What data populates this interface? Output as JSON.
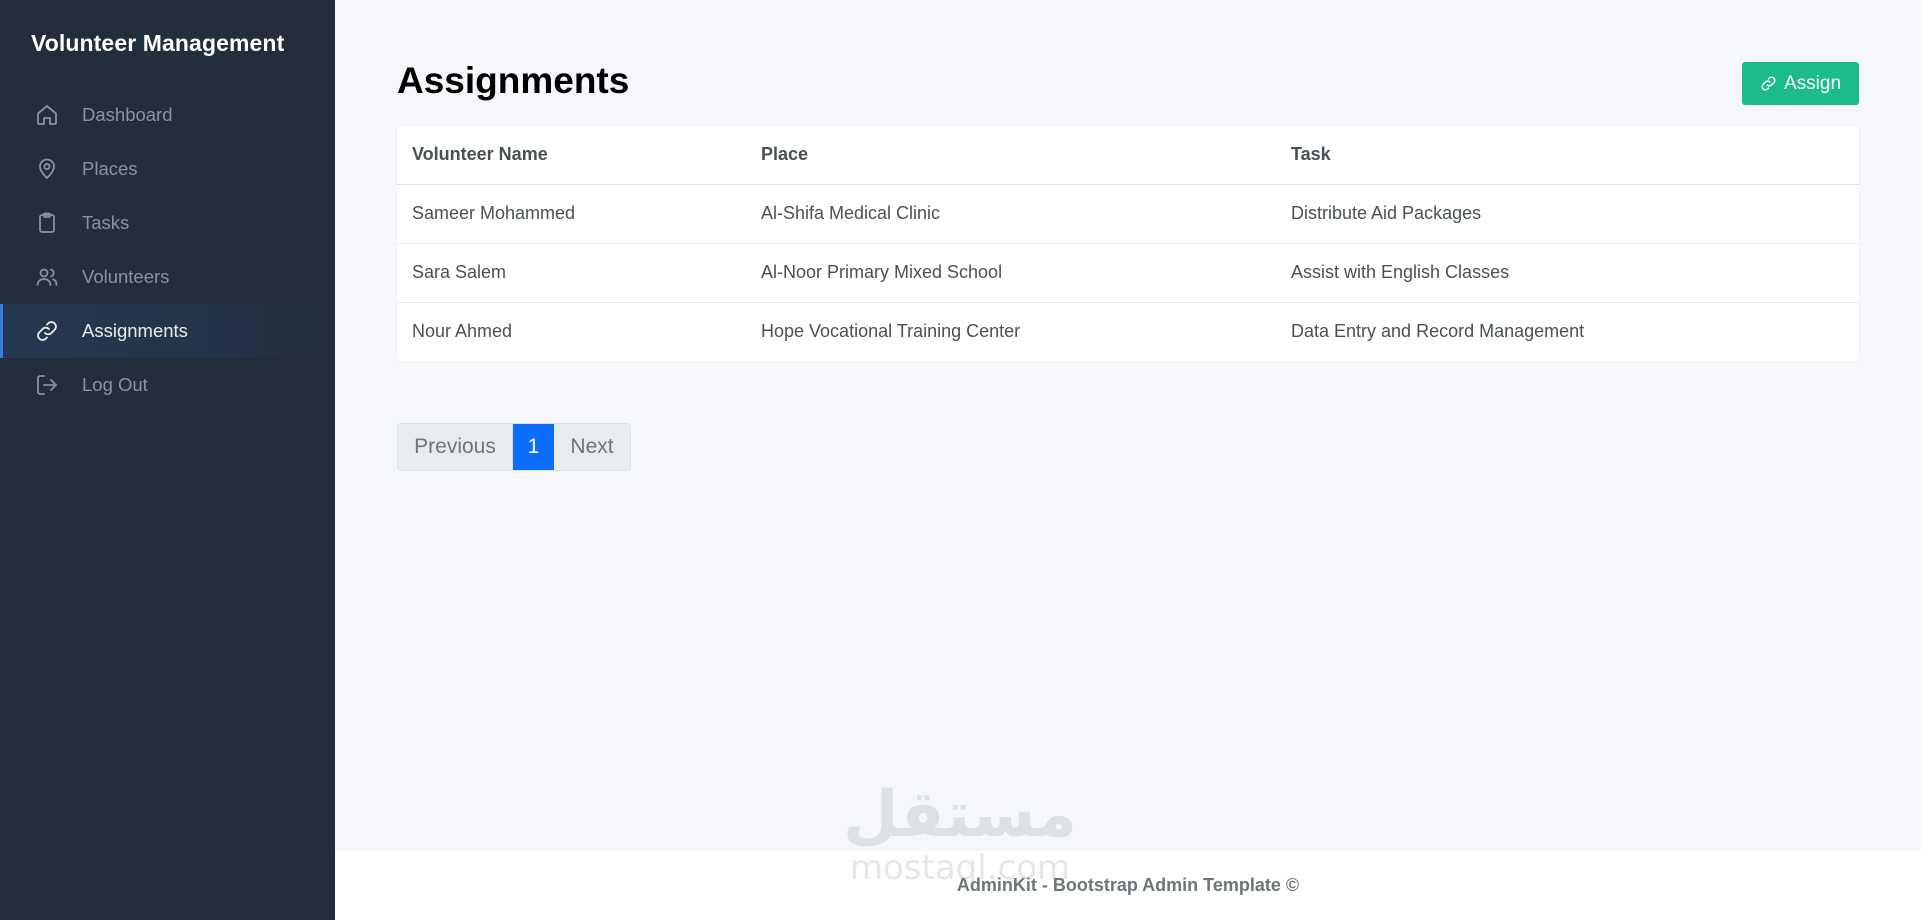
{
  "sidebar": {
    "brand": "Volunteer Management",
    "items": [
      {
        "label": "Dashboard",
        "icon": "home-icon",
        "active": false
      },
      {
        "label": "Places",
        "icon": "map-pin-icon",
        "active": false
      },
      {
        "label": "Tasks",
        "icon": "clipboard-icon",
        "active": false
      },
      {
        "label": "Volunteers",
        "icon": "users-icon",
        "active": false
      },
      {
        "label": "Assignments",
        "icon": "link-icon",
        "active": true
      },
      {
        "label": "Log Out",
        "icon": "log-out-icon",
        "active": false
      }
    ]
  },
  "main": {
    "title": "Assignments",
    "assign_button": {
      "label": "Assign",
      "icon": "link-icon"
    },
    "table": {
      "headers": [
        "Volunteer Name",
        "Place",
        "Task"
      ],
      "rows": [
        [
          "Sameer Mohammed",
          "Al-Shifa Medical Clinic",
          "Distribute Aid Packages"
        ],
        [
          "Sara Salem",
          "Al-Noor Primary Mixed School",
          "Assist with English Classes"
        ],
        [
          "Nour Ahmed",
          "Hope Vocational Training Center",
          "Data Entry and Record Management"
        ]
      ]
    },
    "pagination": {
      "previous": "Previous",
      "current": "1",
      "next": "Next"
    }
  },
  "footer": {
    "text": "AdminKit - Bootstrap Admin Template ©"
  },
  "watermark": {
    "arabic": "مستقل",
    "latin": "mostaql.com"
  },
  "colors": {
    "sidebar_bg": "#222e3c",
    "accent": "#3b7ddd",
    "assign_button": "#1cbb8c",
    "pagination_active": "#0d6efd"
  }
}
